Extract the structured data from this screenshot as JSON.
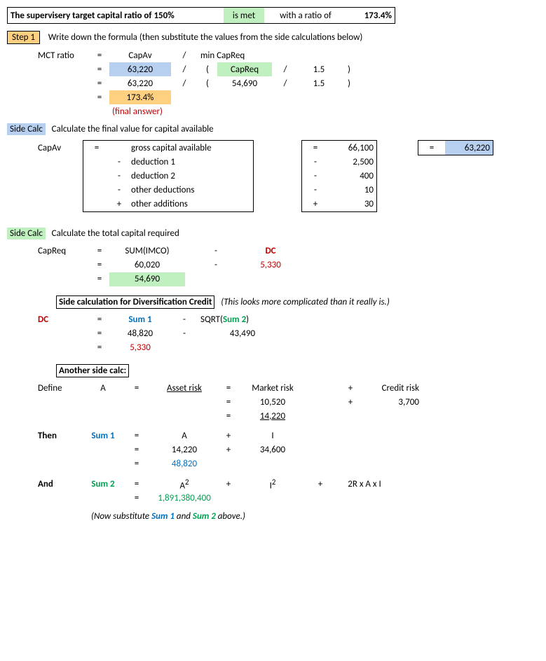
{
  "header": {
    "text1": "The supervisery target capital ratio of 150%",
    "status": "is met",
    "text2": "with a ratio of",
    "ratio": "173.4%"
  },
  "step1": {
    "label": "Step 1",
    "desc": "Write down the formula (then substitute the values from the side calculations below)",
    "row_label": "MCT ratio",
    "capav_label": "CapAv",
    "slash": "/",
    "mincapreq": "min CapReq",
    "capav_val": "63,220",
    "open_p": "(",
    "capreq_label": "CapReq",
    "div": "/",
    "onefive": "1.5",
    "close_p": ")",
    "capreq_val": "54,690",
    "result": "173.4%",
    "final_note": "(final answer)"
  },
  "sidecalc1": {
    "tag": "Side Calc",
    "desc": "Calculate  the final value for capital available",
    "label": "CapAv",
    "r1_txt": "gross capital available",
    "r1_op": "=",
    "r1_val": "66,100",
    "r2_txt": "deduction 1",
    "r2_op": "-",
    "r2_val": "2,500",
    "r3_txt": "deduction 2",
    "r3_op": "-",
    "r3_val": "400",
    "r4_txt": "other deductions",
    "r4_op": "-",
    "r4_val": "10",
    "r5_txt": "other additions",
    "r5_op": "+",
    "r5_val": "30",
    "result": "63,220"
  },
  "sidecalc2": {
    "tag": "Side Calc",
    "desc": "Calculate the total capital required",
    "label": "CapReq",
    "sumimco": "SUM(IMCO)",
    "dc_label": "DC",
    "v1": "60,020",
    "dc_val": "5,330",
    "result": "54,690"
  },
  "dc_section": {
    "title": "Side calculation for Diversification Credit",
    "note": "(This looks more complicated than it really is.)",
    "dc": "DC",
    "sum1": "Sum 1",
    "sqrt_a": "SQRT(",
    "sum2": "Sum 2",
    "sqrt_b": ")",
    "v1": "48,820",
    "v2": "43,490",
    "result": "5,330"
  },
  "another": {
    "title": "Another side calc:",
    "define": "Define",
    "A": "A",
    "asset_risk": "Asset risk",
    "market_risk": "Market risk",
    "credit_risk": "Credit risk",
    "mr_val": "10,520",
    "cr_val": "3,700",
    "a_total": "14,220",
    "then": "Then",
    "sum1": "Sum 1",
    "a_plain": "A",
    "I": "I",
    "a_val": "14,220",
    "i_val": "34,600",
    "sum1_result": "48,820",
    "and": "And",
    "sum2": "Sum 2",
    "a2": "A",
    "i2": "I",
    "rax": "2R x A x I",
    "sum2_result": "1,891,380,400",
    "footer_a": "(Now substitute ",
    "footer_s1": "Sum 1",
    "footer_mid": " and ",
    "footer_s2": "Sum 2",
    "footer_b": " above.)"
  },
  "sym": {
    "eq": "=",
    "minus": "-",
    "plus": "+"
  }
}
